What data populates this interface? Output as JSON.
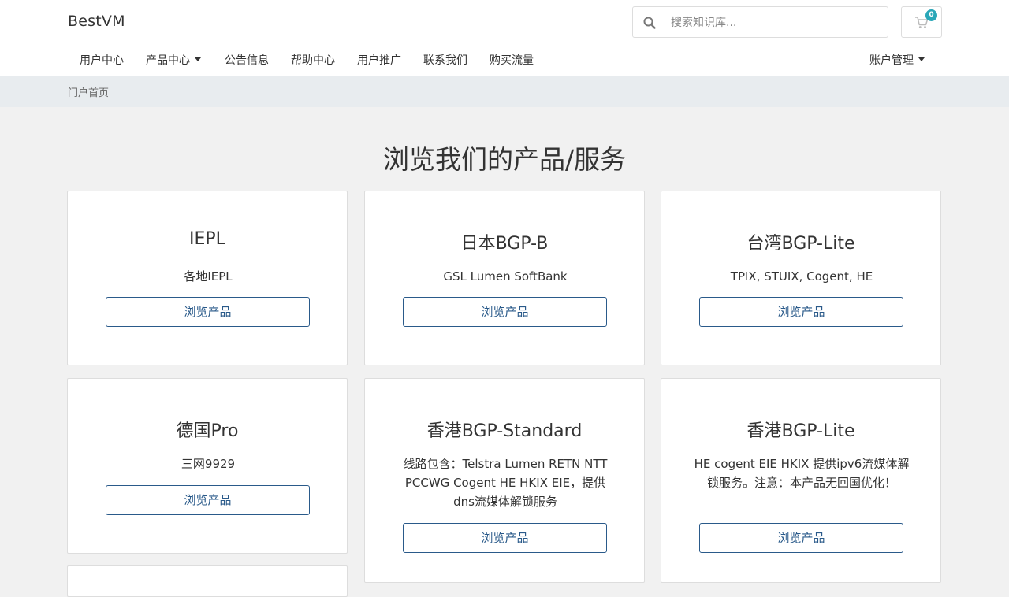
{
  "brand": {
    "name": "BestVM"
  },
  "search": {
    "placeholder": "搜索知识库...",
    "icon": "search-icon"
  },
  "cart": {
    "count": "0",
    "icon": "shopping-cart-icon",
    "badge_color": "#2aa7b8"
  },
  "nav": {
    "items": [
      {
        "label": "用户中心",
        "dropdown": false
      },
      {
        "label": "产品中心",
        "dropdown": true
      },
      {
        "label": "公告信息",
        "dropdown": false
      },
      {
        "label": "帮助中心",
        "dropdown": false
      },
      {
        "label": "用户推广",
        "dropdown": false
      },
      {
        "label": "联系我们",
        "dropdown": false
      },
      {
        "label": "购买流量",
        "dropdown": false
      }
    ],
    "account": {
      "label": "账户管理",
      "dropdown": true
    }
  },
  "breadcrumb": {
    "current": "门户首页"
  },
  "main": {
    "title": "浏览我们的产品/服务",
    "products": [
      {
        "name": "IEPL",
        "desc": "各地IEPL",
        "button": "浏览产品"
      },
      {
        "name": "日本BGP-B",
        "desc": "GSL Lumen SoftBank",
        "button": "浏览产品"
      },
      {
        "name": "台湾BGP-Lite",
        "desc": "TPIX, STUIX, Cogent, HE",
        "button": "浏览产品"
      },
      {
        "name": "德国Pro",
        "desc": "三网9929",
        "button": "浏览产品"
      },
      {
        "name": "香港BGP-Standard",
        "desc": "线路包含：Telstra Lumen RETN NTT PCCWG Cogent HE HKIX EIE，提供dns流媒体解锁服务",
        "button": "浏览产品"
      },
      {
        "name": "香港BGP-Lite",
        "desc": "HE cogent EIE HKIX 提供ipv6流媒体解锁服务。注意：本产品无回国优化！",
        "button": "浏览产品"
      }
    ]
  },
  "colors": {
    "accent": "#2a5a8a",
    "breadcrumb_bg": "#e8ecef",
    "page_bg": "#f1f1f1"
  }
}
